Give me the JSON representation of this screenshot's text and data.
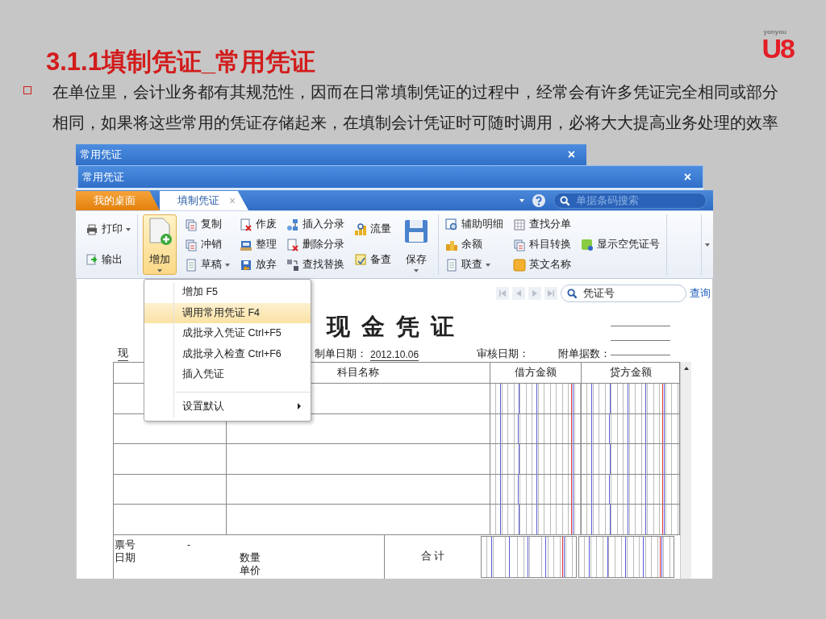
{
  "slide": {
    "title": "3.1.1填制凭证_常用凭证",
    "paragraph": "在单位里，会计业务都有其规范性，因而在日常填制凭证的过程中，经常会有许多凭证完全相同或部分相同，如果将这些常用的凭证存储起来，在填制会计凭证时可随时调用，必将大大提高业务处理的效率"
  },
  "logo": {
    "brand": "yonyou",
    "product": "U8"
  },
  "windows": [
    {
      "title": "常用凭证",
      "close": "×"
    },
    {
      "title": "常用凭证",
      "close": "×"
    }
  ],
  "tabs": [
    {
      "label": "我的桌面",
      "selected": false
    },
    {
      "label": "填制凭证",
      "selected": true,
      "close": "×"
    }
  ],
  "search": {
    "placeholder": "单据条码搜索"
  },
  "ribbon": {
    "groups": [
      {
        "columns": [
          {
            "kind": "stack",
            "items": [
              {
                "label": "打印",
                "dropdown": true
              },
              {
                "label": "输出",
                "dropdown": false
              }
            ]
          }
        ]
      },
      {
        "columns": [
          {
            "kind": "large",
            "label": "增加",
            "dropdown": true,
            "selected": true
          },
          {
            "kind": "stack",
            "items": [
              {
                "label": "复制",
                "dropdown": false
              },
              {
                "label": "冲销",
                "dropdown": false
              },
              {
                "label": "草稿",
                "dropdown": true
              }
            ]
          },
          {
            "kind": "stack",
            "items": [
              {
                "label": "作废",
                "dropdown": false
              },
              {
                "label": "整理",
                "dropdown": false
              },
              {
                "label": "放弃",
                "dropdown": false
              }
            ]
          },
          {
            "kind": "stack",
            "items": [
              {
                "label": "插入分录",
                "dropdown": false
              },
              {
                "label": "删除分录",
                "dropdown": false
              },
              {
                "label": "查找替换",
                "dropdown": false
              }
            ]
          },
          {
            "kind": "stack",
            "items": [
              {
                "label": "流量",
                "dropdown": false
              },
              {
                "label": "备查",
                "dropdown": false
              }
            ]
          },
          {
            "kind": "large",
            "label": "保存",
            "dropdown": true,
            "selected": false
          }
        ]
      },
      {
        "columns": [
          {
            "kind": "stack",
            "items": [
              {
                "label": "辅助明细",
                "dropdown": false
              },
              {
                "label": "余额",
                "dropdown": false
              },
              {
                "label": "联查",
                "dropdown": true
              }
            ]
          },
          {
            "kind": "stack",
            "items": [
              {
                "label": "查找分单",
                "dropdown": false
              },
              {
                "label": "科目转换",
                "dropdown": false
              },
              {
                "label": "英文名称",
                "dropdown": false
              }
            ]
          },
          {
            "kind": "stack",
            "items": [
              {
                "label": "显示空凭证号",
                "dropdown": false
              }
            ]
          }
        ]
      }
    ]
  },
  "menu": {
    "items": [
      {
        "label": "增加 F5",
        "selected": false,
        "separator_before": false,
        "submenu": false
      },
      {
        "label": "调用常用凭证 F4",
        "selected": true,
        "separator_before": false,
        "submenu": false
      },
      {
        "label": "成批录入凭证 Ctrl+F5",
        "selected": false,
        "separator_before": false,
        "submenu": false
      },
      {
        "label": "成批录入检查 Ctrl+F6",
        "selected": false,
        "separator_before": false,
        "submenu": false
      },
      {
        "label": "插入凭证",
        "selected": false,
        "separator_before": false,
        "submenu": false
      },
      {
        "label": "设置默认",
        "selected": false,
        "separator_before": true,
        "submenu": true
      }
    ]
  },
  "voucher": {
    "number_search": {
      "placeholder": "凭证号"
    },
    "query_link": "查询",
    "type": "现",
    "title": "现 金 凭 证",
    "date_label": "制单日期：",
    "date": "2012.10.06",
    "audit_label": "审核日期：",
    "attachments_label": "附单据数：",
    "columns": [
      "科目名称",
      "借方金额",
      "贷方金额"
    ],
    "footer": {
      "ticket_label": "票号",
      "ticket_value": "-",
      "date_label": "日期",
      "quantity_label": "数量",
      "price_label": "单价",
      "total_label": "合 计"
    }
  }
}
